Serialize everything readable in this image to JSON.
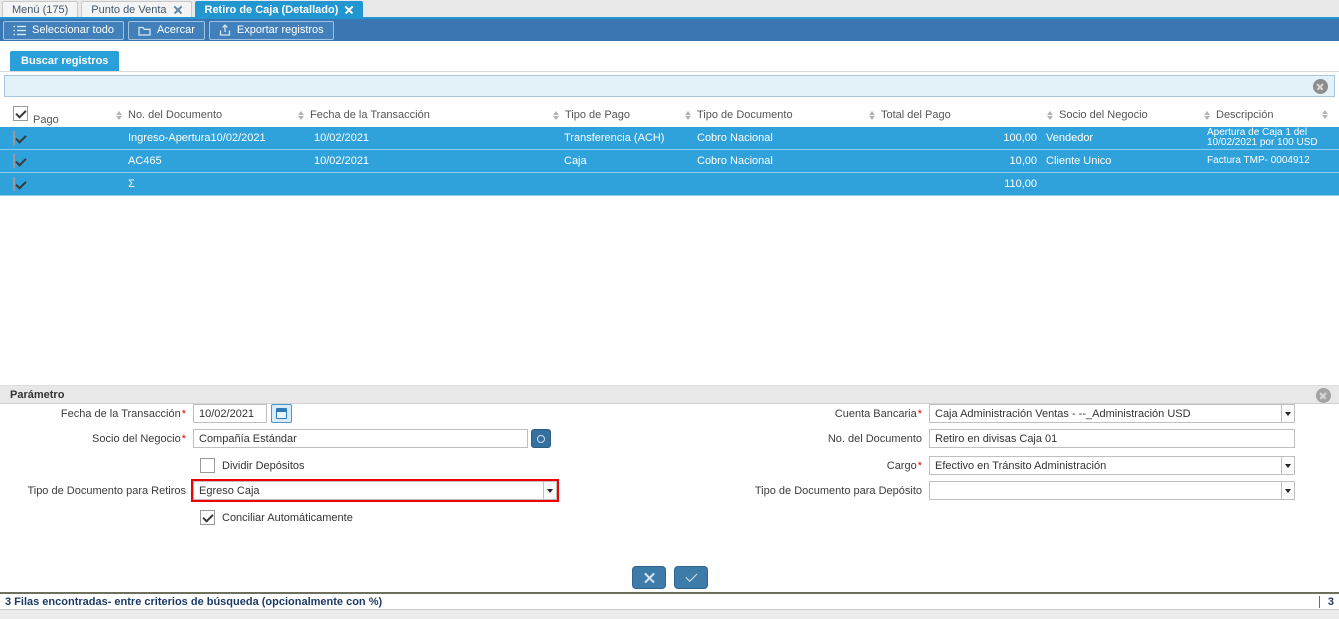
{
  "tabs": [
    {
      "label": "Menú (175)",
      "closable": false,
      "active": false
    },
    {
      "label": "Punto de Venta",
      "closable": true,
      "active": false
    },
    {
      "label": "Retiro de Caja (Detallado)",
      "closable": true,
      "active": true
    }
  ],
  "toolbar": {
    "select_all_label": "Seleccionar todo",
    "zoom_label": "Acercar",
    "export_label": "Exportar registros"
  },
  "search": {
    "tab_label": "Buscar registros",
    "input_value": ""
  },
  "table": {
    "pago_header": "Pago",
    "columns": [
      "No. del Documento",
      "Fecha de la Transacción",
      "Tipo de Pago",
      "Tipo de Documento",
      "Total del Pago",
      "Socio del Negocio",
      "Descripción"
    ],
    "rows": [
      {
        "checked": true,
        "doc": "Ingreso-Apertura10/02/2021",
        "fecha": "10/02/2021",
        "tipo_pago": "Transferencia (ACH)",
        "tipo_doc": "Cobro Nacional",
        "total": "100,00",
        "socio": "Vendedor",
        "desc": "Apertura de Caja 1 del 10/02/2021 por 100 USD"
      },
      {
        "checked": true,
        "doc": "AC465",
        "fecha": "10/02/2021",
        "tipo_pago": "Caja",
        "tipo_doc": "Cobro Nacional",
        "total": "10,00",
        "socio": "Cliente Unico",
        "desc": "Factura TMP- 0004912"
      },
      {
        "checked": true,
        "doc": "Σ",
        "total": "110,00"
      }
    ]
  },
  "parameters": {
    "title": "Parámetro",
    "required_mark": "*",
    "fecha": {
      "label": "Fecha de la Transacción",
      "value": "10/02/2021"
    },
    "socio": {
      "label": "Socio del Negocio",
      "value": "Compañía Estándar"
    },
    "dividir": {
      "label": "Dividir Depósitos",
      "checked": false
    },
    "tipo_retiro": {
      "label": "Tipo de Documento para Retiros",
      "value": "Egreso Caja"
    },
    "conciliar": {
      "label": "Conciliar Automáticamente",
      "checked": true
    },
    "cuenta": {
      "label": "Cuenta Bancaria",
      "value": "Caja Administración Ventas - --_Administración USD"
    },
    "no_doc": {
      "label": "No. del Documento",
      "value": "Retiro en divisas Caja 01"
    },
    "cargo": {
      "label": "Cargo",
      "value": "Efectivo en Tránsito Administración"
    },
    "tipo_deposito": {
      "label": "Tipo de Documento para Depósito",
      "value": ""
    }
  },
  "status": {
    "message": "3 Filas encontradas- entre criterios de búsqueda (opcionalmente con %)",
    "count": "3"
  },
  "colors": {
    "accent_blue": "#2196d0",
    "row_selection_blue": "#2fa2dc",
    "toolbar_blue": "#3a77b2",
    "highlight_red": "#ee0000"
  }
}
